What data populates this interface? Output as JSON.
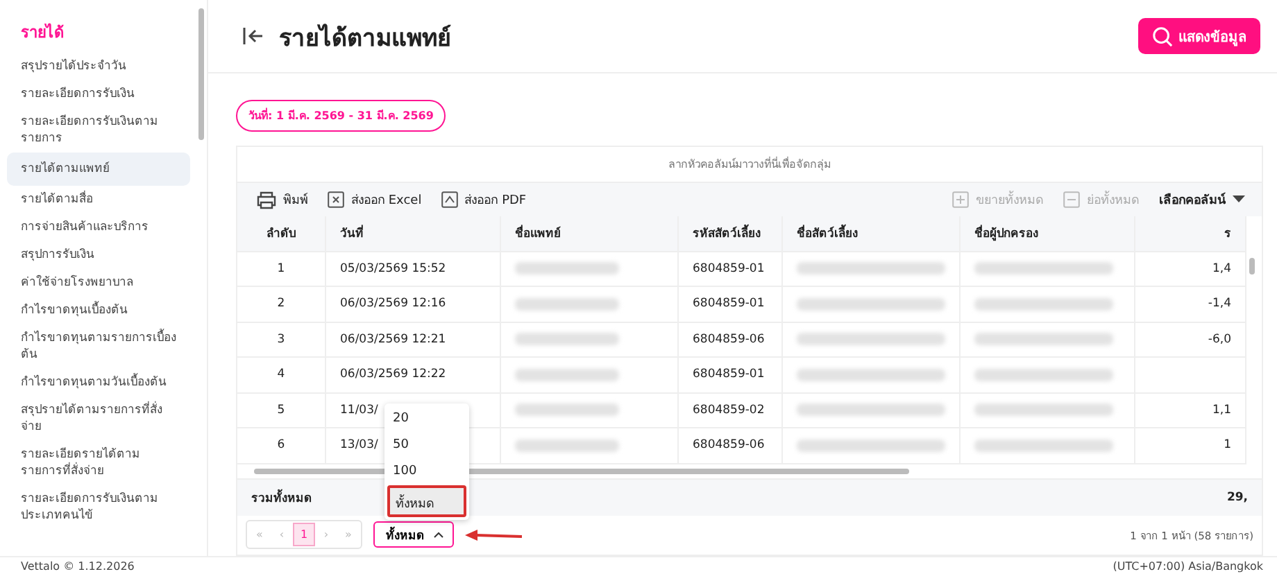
{
  "sidebar": {
    "section_title": "รายได้",
    "items": [
      {
        "label": "สรุปรายได้ประจำวัน",
        "selected": false
      },
      {
        "label": "รายละเอียดการรับเงิน",
        "selected": false
      },
      {
        "label": "รายละเอียดการรับเงินตามรายการ",
        "selected": false
      },
      {
        "label": "รายได้ตามแพทย์",
        "selected": true
      },
      {
        "label": "รายได้ตามสื่อ",
        "selected": false
      },
      {
        "label": "การจ่ายสินค้าและบริการ",
        "selected": false
      },
      {
        "label": "สรุปการรับเงิน",
        "selected": false
      },
      {
        "label": "ค่าใช้จ่ายโรงพยาบาล",
        "selected": false
      },
      {
        "label": "กำไรขาดทุนเบื้องต้น",
        "selected": false
      },
      {
        "label": "กำไรขาดทุนตามรายการเบื้องต้น",
        "selected": false
      },
      {
        "label": "กำไรขาดทุนตามวันเบื้องต้น",
        "selected": false
      },
      {
        "label": "สรุปรายได้ตามรายการที่สั่งจ่าย",
        "selected": false
      },
      {
        "label": "รายละเอียดรายได้ตามรายการที่สั่งจ่าย",
        "selected": false
      },
      {
        "label": "รายละเอียดการรับเงินตามประเภทคนไข้",
        "selected": false
      }
    ]
  },
  "header": {
    "title": "รายได้ตามแพทย์",
    "search_button": "แสดงข้อมูล"
  },
  "date_filter": "วันที่: 1 มี.ค. 2569 - 31 มี.ค. 2569",
  "grid": {
    "group_panel": "ลากหัวคอลัมน์มาวางที่นี่เพื่อจัดกลุ่ม",
    "toolbar": [
      {
        "kind": "print",
        "label": "พิมพ์",
        "disabled": false
      },
      {
        "kind": "excel",
        "label": "ส่งออก Excel",
        "disabled": false
      },
      {
        "kind": "pdf",
        "label": "ส่งออก PDF",
        "disabled": false
      },
      {
        "kind": "expand",
        "label": "ขยายทั้งหมด",
        "disabled": true
      },
      {
        "kind": "collapse",
        "label": "ย่อทั้งหมด",
        "disabled": true
      },
      {
        "kind": "columns",
        "label": "เลือกคอลัมน์",
        "disabled": false
      }
    ],
    "columns": [
      "ลำดับ",
      "วันที่",
      "ชื่อแพทย์",
      "รหัสสัตว์เลี้ยง",
      "ชื่อสัตว์เลี้ยง",
      "ชื่อผู้ปกครอง",
      "ร"
    ],
    "rows": [
      {
        "no": "1",
        "date": "05/03/2569 15:52",
        "pet_code": "6804859-01",
        "amount": "1,4"
      },
      {
        "no": "2",
        "date": "06/03/2569 12:16",
        "pet_code": "6804859-01",
        "amount": "-1,4"
      },
      {
        "no": "3",
        "date": "06/03/2569 12:21",
        "pet_code": "6804859-06",
        "amount": "-6,0"
      },
      {
        "no": "4",
        "date": "06/03/2569 12:22",
        "pet_code": "6804859-01"
      },
      {
        "no": "5",
        "date": "11/03/",
        "pet_code": "6804859-02",
        "amount": "1,1"
      },
      {
        "no": "6",
        "date": "13/03/",
        "pet_code": "6804859-06",
        "amount": "1"
      }
    ],
    "total_label": "รวมทั้งหมด",
    "total_value": "29,",
    "pager": {
      "buttons": [
        {
          "label": "«",
          "disabled": true
        },
        {
          "label": "‹",
          "disabled": true
        },
        {
          "label": "1",
          "disabled": false
        },
        {
          "label": "›",
          "disabled": true
        },
        {
          "label": "»",
          "disabled": true
        }
      ],
      "page_size": "ทั้งหมด",
      "options": [
        {
          "label": "20",
          "selected": false
        },
        {
          "label": "50",
          "selected": false
        },
        {
          "label": "100",
          "selected": false
        },
        {
          "label": "ทั้งหมด",
          "selected": true
        }
      ],
      "info": "1 จาก 1 หน้า (58 รายการ)"
    }
  },
  "footer": {
    "left": "Vettalo © 1.12.2026",
    "right": "(UTC+07:00) Asia/Bangkok"
  }
}
